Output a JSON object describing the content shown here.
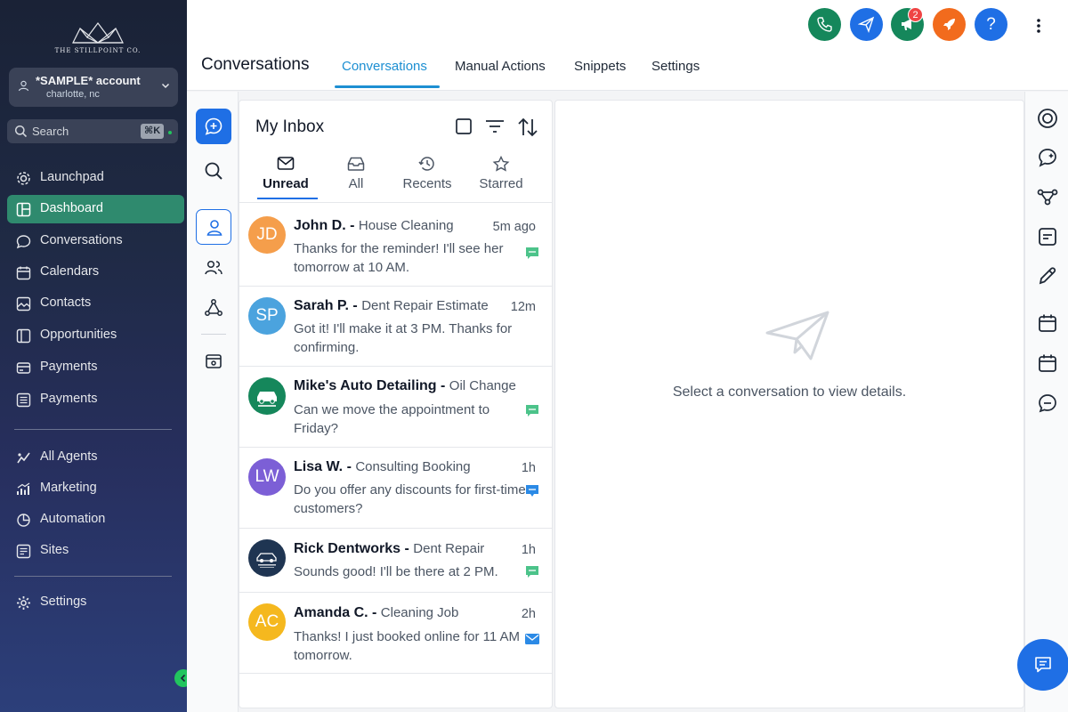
{
  "brand": {
    "logo_text": "THE STILLPOINT CO."
  },
  "account": {
    "name": "*SAMPLE* account",
    "location": "charlotte, nc"
  },
  "search": {
    "placeholder": "Search",
    "shortcut": "⌘K"
  },
  "sidebar": {
    "items": [
      {
        "label": "Launchpad",
        "icon": "rocket-gear-icon"
      },
      {
        "label": "Dashboard",
        "icon": "dashboard-icon",
        "active": true
      },
      {
        "label": "Conversations",
        "icon": "chat-icon"
      },
      {
        "label": "Calendars",
        "icon": "calendar-icon"
      },
      {
        "label": "Contacts",
        "icon": "contacts-icon"
      },
      {
        "label": "Opportunities",
        "icon": "opportunities-icon"
      },
      {
        "label": "Payments",
        "icon": "payments-icon"
      },
      {
        "label": "Payments",
        "icon": "invoice-icon"
      }
    ],
    "items2": [
      {
        "label": "All Agents",
        "icon": "agents-icon"
      },
      {
        "label": "Marketing",
        "icon": "marketing-icon"
      },
      {
        "label": "Automation",
        "icon": "automation-icon"
      },
      {
        "label": "Sites",
        "icon": "sites-icon"
      }
    ],
    "settings_label": "Settings"
  },
  "header": {
    "title": "Conversations",
    "tabs": [
      {
        "label": "Conversations",
        "active": true
      },
      {
        "label": "Manual Actions"
      },
      {
        "label": "Snippets"
      },
      {
        "label": "Settings"
      }
    ],
    "notification_count": "2",
    "help_label": "?"
  },
  "inbox": {
    "title": "My Inbox",
    "filters": [
      {
        "label": "Unread",
        "active": true
      },
      {
        "label": "All"
      },
      {
        "label": "Recents"
      },
      {
        "label": "Starred"
      }
    ],
    "conversations": [
      {
        "name": "John D.",
        "service": "House Cleaning",
        "time": "5m ago",
        "message": "Thanks for the reminder! I'll see her tomorrow at 10 AM.",
        "initials": "JD",
        "color": "#f59e4b",
        "channel": "sms"
      },
      {
        "name": "Sarah P.",
        "service": "Dent Repair Estimate",
        "time": "12m",
        "message": "Got it! I'll make it at 3 PM. Thanks for confirming.",
        "initials": "SP",
        "color": "#4ba3de",
        "channel": "none"
      },
      {
        "name": "Mike's Auto Detailing",
        "service": "Oil Change",
        "time": "",
        "message": "Can we move the appointment to Friday?",
        "initials": "",
        "color": "#15875b",
        "channel": "sms"
      },
      {
        "name": "Lisa W.",
        "service": "Consulting Booking",
        "time": "1h",
        "message": "Do you offer any discounts for first-time customers?",
        "initials": "LW",
        "color": "#7c5fd6",
        "channel": "chat"
      },
      {
        "name": "Rick Dentworks",
        "service": "Dent Repair",
        "time": "1h",
        "message": "Sounds good! I'll be there at 2 PM.",
        "initials": "",
        "color": "#1f3552",
        "channel": "sms"
      },
      {
        "name": "Amanda C.",
        "service": "Cleaning Job",
        "time": "2h",
        "message": "Thanks! I just booked online for 11 AM tomorrow.",
        "initials": "AC",
        "color": "#f5b81e",
        "channel": "email"
      }
    ]
  },
  "detail": {
    "empty_text": "Select a conversation to view details."
  },
  "colors": {
    "accent": "#1f6fe5",
    "active_nav": "#2f8a6e",
    "tab_active": "#1d8fd2"
  }
}
